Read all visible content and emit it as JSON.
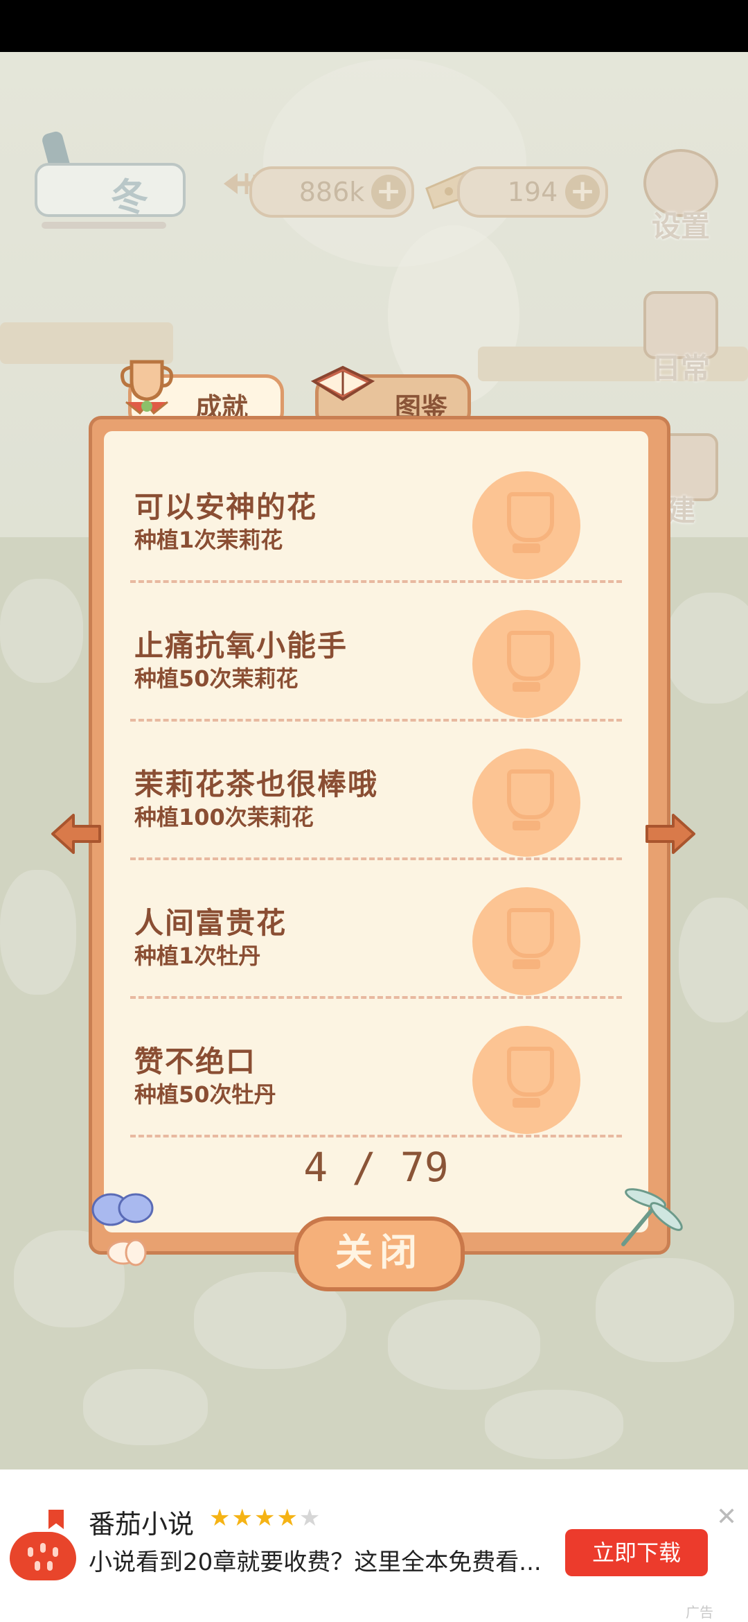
{
  "hud": {
    "season_label": "冬",
    "fish_count": "886k",
    "cheese_count": "194",
    "plus_symbol": "+",
    "settings_label": "设置",
    "daily_label": "日常",
    "build_label": "建"
  },
  "tabs": {
    "achievements": "成就",
    "collection": "图鉴"
  },
  "achievements": [
    {
      "title": "可以安神的花",
      "description": "种植1次茉莉花"
    },
    {
      "title": "止痛抗氧小能手",
      "description": "种植50次茉莉花"
    },
    {
      "title": "茉莉花茶也很棒哦",
      "description": "种植100次茉莉花"
    },
    {
      "title": "人间富贵花",
      "description": "种植1次牡丹"
    },
    {
      "title": "赞不绝口",
      "description": "种植50次牡丹"
    }
  ],
  "pager": "4 / 79",
  "close_label": "关闭",
  "ad": {
    "app_name": "番茄小说",
    "rating": 4,
    "stars_filled": "★★★★",
    "stars_empty": "★",
    "tagline": "小说看到20章就要收费？这里全本免费看...",
    "download_label": "立即下载",
    "close_symbol": "✕",
    "ad_label": "广告",
    "accent": "#ec3b2c"
  }
}
